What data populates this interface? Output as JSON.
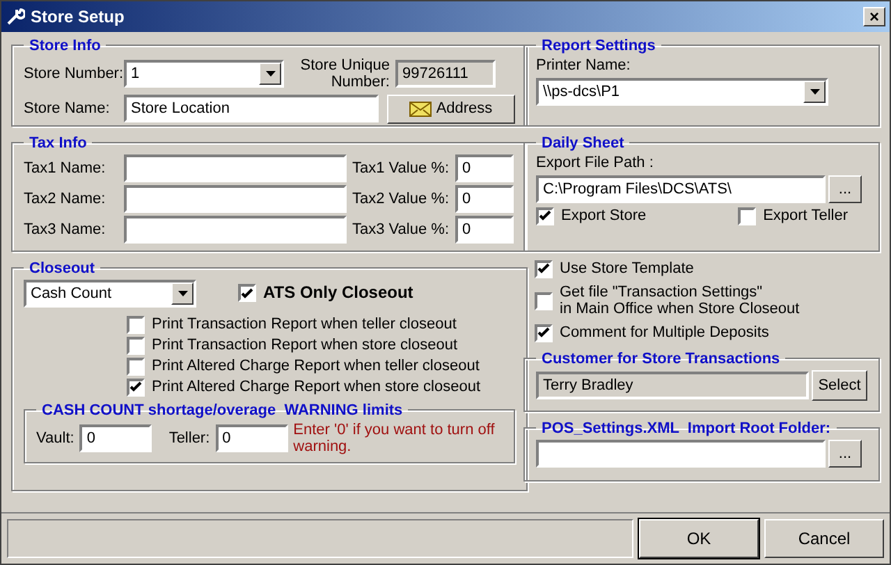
{
  "window": {
    "title": "Store Setup",
    "close": "×"
  },
  "store_info": {
    "title": "Store Info",
    "store_number_label": "Store Number:",
    "store_number": "1",
    "unique_label": "Store Unique Number:",
    "unique_value": "99726111",
    "store_name_label": "Store Name:",
    "store_name": "Store Location",
    "address_button": "Address"
  },
  "tax_info": {
    "title": "Tax Info",
    "rows": [
      {
        "name_label": "Tax1 Name:",
        "name": "",
        "value_label": "Tax1 Value %:",
        "value": "0"
      },
      {
        "name_label": "Tax2 Name:",
        "name": "",
        "value_label": "Tax2 Value %:",
        "value": "0"
      },
      {
        "name_label": "Tax3 Name:",
        "name": "",
        "value_label": "Tax3 Value %:",
        "value": "0"
      }
    ]
  },
  "closeout": {
    "title": "Closeout",
    "mode": "Cash Count",
    "ats_only": {
      "label": "ATS Only Closeout",
      "checked": true
    },
    "options": [
      {
        "label": "Print Transaction Report when teller closeout",
        "checked": false
      },
      {
        "label": "Print Transaction Report when store closeout",
        "checked": false
      },
      {
        "label": "Print Altered Charge Report when teller closeout",
        "checked": false
      },
      {
        "label": "Print Altered Charge Report when store closeout",
        "checked": true
      }
    ],
    "limits": {
      "title": "CASH COUNT shortage/overage  WARNING limits",
      "vault_label": "Vault:",
      "vault": "0",
      "teller_label": "Teller:",
      "teller": "0",
      "note": "Enter '0' if you want to turn off warning."
    }
  },
  "report_settings": {
    "title": "Report Settings",
    "printer_label": "Printer Name:",
    "printer": "\\\\ps-dcs\\P1"
  },
  "daily_sheet": {
    "title": "Daily Sheet",
    "path_label": "Export File Path :",
    "path": "C:\\Program Files\\DCS\\ATS\\",
    "browse": "...",
    "export_store": {
      "label": "Export Store",
      "checked": true
    },
    "export_teller": {
      "label": "Export Teller",
      "checked": false
    }
  },
  "options": [
    {
      "label": "Use Store Template",
      "checked": true
    },
    {
      "label": "Get file \"Transaction Settings\"\nin Main Office when Store Closeout",
      "checked": false
    },
    {
      "label": "Comment for Multiple Deposits",
      "checked": true
    }
  ],
  "customer": {
    "title": "Customer for Store Transactions",
    "value": "Terry Bradley",
    "select_button": "Select"
  },
  "pos_import": {
    "title": "POS_Settings.XML  Import Root Folder:",
    "browse": "..."
  },
  "buttons": [
    {
      "label": "OK"
    },
    {
      "label": "Cancel"
    }
  ]
}
